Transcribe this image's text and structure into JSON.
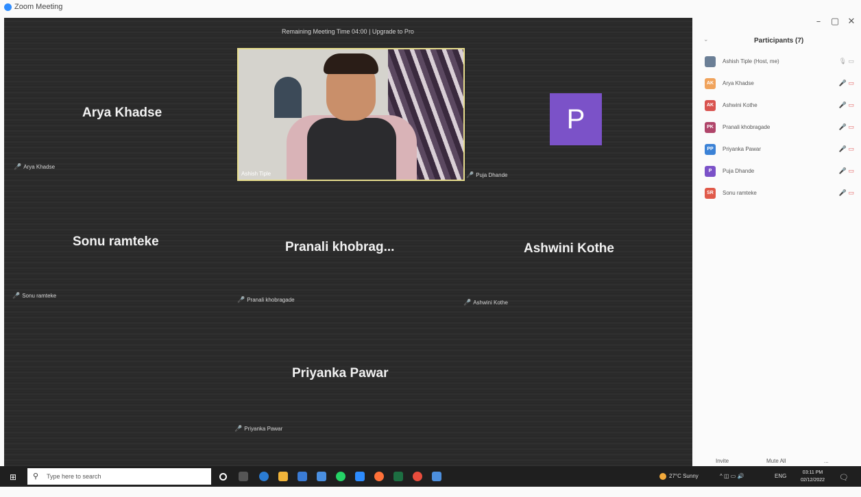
{
  "window": {
    "title": "Zoom Meeting",
    "minimize": "–",
    "restore": "▢",
    "close": "✕"
  },
  "meeting": {
    "remaining_time": "Remaining Meeting Time 04:00 | Upgrade to Pro",
    "main_video_name": "Ashish Tiple",
    "avatar_letter": "P",
    "tiles": [
      {
        "big_name": "Arya Khadse",
        "label": "Arya Khadse"
      },
      {
        "big_name": "",
        "label": "Puja Dhande"
      },
      {
        "big_name": "Sonu ramteke",
        "label": "Sonu ramteke"
      },
      {
        "big_name": "Pranali  khobrag...",
        "label": "Pranali khobragade"
      },
      {
        "big_name": "Ashwini Kothe",
        "label": "Ashwini Kothe"
      },
      {
        "big_name": "Priyanka Pawar",
        "label": "Priyanka Pawar"
      }
    ]
  },
  "participants": {
    "title": "Participants (7)",
    "list": [
      {
        "initials": "",
        "name": "Ashish Tiple (Host, me)",
        "color": "#6b7f96",
        "host": true
      },
      {
        "initials": "AK",
        "name": "Arya Khadse",
        "color": "#f0a35c"
      },
      {
        "initials": "AK",
        "name": "Ashwini Kothe",
        "color": "#d9534f"
      },
      {
        "initials": "PK",
        "name": "Pranali khobragade",
        "color": "#b0456a"
      },
      {
        "initials": "PP",
        "name": "Priyanka Pawar",
        "color": "#3b82d6"
      },
      {
        "initials": "P",
        "name": "Puja Dhande",
        "color": "#7b52c8"
      },
      {
        "initials": "SR",
        "name": "Sonu ramteke",
        "color": "#e05a4a"
      }
    ],
    "invite_label": "Invite",
    "mute_all_label": "Mute All",
    "more_label": "..."
  },
  "taskbar": {
    "search_placeholder": "Type here to search",
    "weather": "27°C  Sunny",
    "lang": "ENG",
    "time": "03:11 PM",
    "date": "02/12/2022"
  }
}
